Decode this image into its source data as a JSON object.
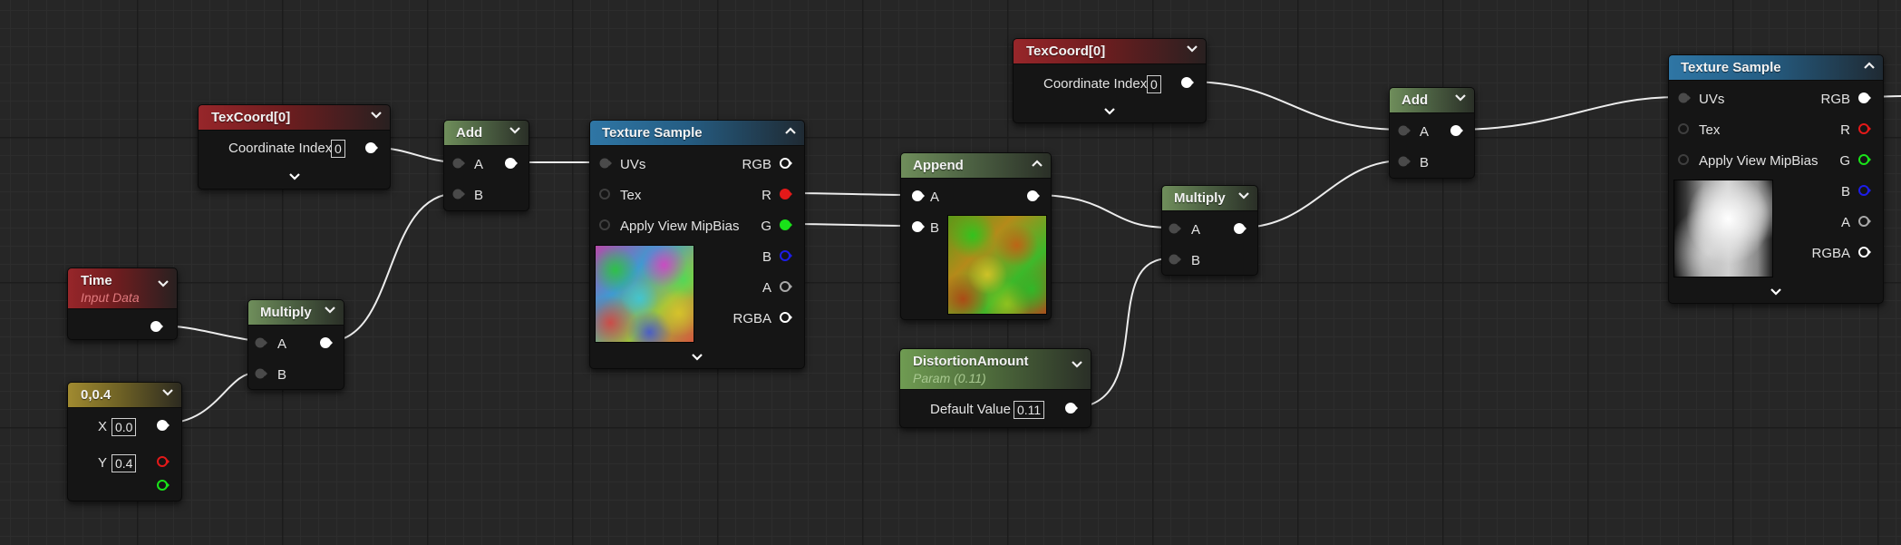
{
  "colors": {
    "canvas": "#262626",
    "node_body": "#151515",
    "header_red": "#97262a",
    "header_green": "#6f8e5b",
    "header_blue": "#2f76a5",
    "header_olive": "#a08a30",
    "pin_red": "#e31919",
    "pin_green": "#19e319",
    "pin_blue": "#1d1de8",
    "pin_white": "#ffffff",
    "wire": "#ededed"
  },
  "icons": {
    "collapse": "chevron-down-icon",
    "expand_up": "chevron-up-icon",
    "advanced": "expander-arrow-icon",
    "pin": "pin-circle-icon"
  },
  "nodes": {
    "texcoord1": {
      "title": "TexCoord[0]",
      "coord_label": "Coordinate Index",
      "coord_value": "0"
    },
    "time": {
      "title": "Time",
      "subtitle": "Input Data"
    },
    "const2": {
      "title": "0,0.4",
      "x_label": "X",
      "x_value": "0.0",
      "y_label": "Y",
      "y_value": "0.4"
    },
    "multiply1": {
      "title": "Multiply",
      "a": "A",
      "b": "B"
    },
    "add1": {
      "title": "Add",
      "a": "A",
      "b": "B"
    },
    "texsample1": {
      "title": "Texture Sample",
      "uvs": "UVs",
      "tex": "Tex",
      "mipbias": "Apply View MipBias",
      "rgb": "RGB",
      "r": "R",
      "g": "G",
      "b": "B",
      "a": "A",
      "rgba": "RGBA"
    },
    "append": {
      "title": "Append",
      "a": "A",
      "b": "B"
    },
    "distortion": {
      "title": "DistortionAmount",
      "subtitle": "Param (0.11)",
      "default_label": "Default Value",
      "default_value": "0.11"
    },
    "multiply2": {
      "title": "Multiply",
      "a": "A",
      "b": "B"
    },
    "texcoord2": {
      "title": "TexCoord[0]",
      "coord_label": "Coordinate Index",
      "coord_value": "0"
    },
    "add2": {
      "title": "Add",
      "a": "A",
      "b": "B"
    },
    "texsample2": {
      "title": "Texture Sample",
      "uvs": "UVs",
      "tex": "Tex",
      "mipbias": "Apply View MipBias",
      "rgb": "RGB",
      "r": "R",
      "g": "G",
      "b": "B",
      "a": "A",
      "rgba": "RGBA"
    }
  }
}
